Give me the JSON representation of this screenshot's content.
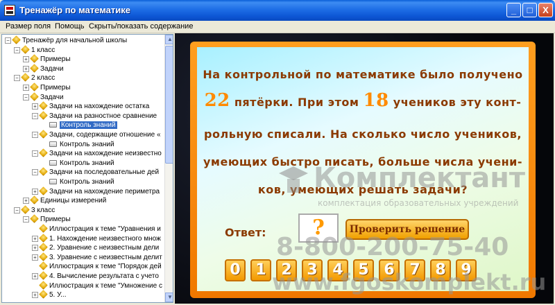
{
  "window": {
    "title": "Тренажёр по математике",
    "buttons": {
      "minimize": "_",
      "maximize": "□",
      "close": "X"
    }
  },
  "menu": [
    "Размер поля",
    "Помощь",
    "Скрыть/показать содержание"
  ],
  "tree": [
    {
      "label": "Тренажёр для начальной школы",
      "level": 0,
      "expander": "−"
    },
    {
      "label": "1 класс",
      "level": 1,
      "expander": "−"
    },
    {
      "label": "Примеры",
      "level": 2,
      "expander": "+"
    },
    {
      "label": "Задачи",
      "level": 2,
      "expander": "+"
    },
    {
      "label": "2 класс",
      "level": 1,
      "expander": "−"
    },
    {
      "label": "Примеры",
      "level": 2,
      "expander": "+"
    },
    {
      "label": "Задачи",
      "level": 2,
      "expander": "−"
    },
    {
      "label": "Задачи на нахождение остатка",
      "level": 3,
      "expander": "+"
    },
    {
      "label": "Задачи на разностное сравнение",
      "level": 3,
      "expander": "−"
    },
    {
      "label": "Контроль знаний",
      "level": 4,
      "expander": "",
      "selected": true,
      "leaf": true
    },
    {
      "label": "Задачи, содержащие отношение «",
      "level": 3,
      "expander": "−"
    },
    {
      "label": "Контроль знаний",
      "level": 4,
      "expander": "",
      "leaf": true
    },
    {
      "label": "Задачи на нахождение неизвестно",
      "level": 3,
      "expander": "−"
    },
    {
      "label": "Контроль знаний",
      "level": 4,
      "expander": "",
      "leaf": true
    },
    {
      "label": "Задачи на последовательные дей",
      "level": 3,
      "expander": "−"
    },
    {
      "label": "Контроль знаний",
      "level": 4,
      "expander": "",
      "leaf": true
    },
    {
      "label": "Задачи на нахождение периметра",
      "level": 3,
      "expander": "+"
    },
    {
      "label": "Единицы измерений",
      "level": 2,
      "expander": "+"
    },
    {
      "label": "3 класс",
      "level": 1,
      "expander": "−"
    },
    {
      "label": "Примеры",
      "level": 2,
      "expander": "−"
    },
    {
      "label": "Иллюстрация к теме \"Уравнения и",
      "level": 3,
      "expander": ""
    },
    {
      "label": "1. Нахождение неизвестного множ",
      "level": 3,
      "expander": "+"
    },
    {
      "label": "2. Уравнение с неизвестным дели",
      "level": 3,
      "expander": "+"
    },
    {
      "label": "3. Уравнение с неизвестным делит",
      "level": 3,
      "expander": "+"
    },
    {
      "label": "Иллюстрация к теме \"Порядок дей",
      "level": 3,
      "expander": ""
    },
    {
      "label": "4. Вычисление результата с учето",
      "level": 3,
      "expander": "+"
    },
    {
      "label": "Иллюстрация к теме \"Умножение с",
      "level": 3,
      "expander": ""
    },
    {
      "label": "5. У...",
      "level": 3,
      "expander": "+"
    }
  ],
  "scrollbar": {
    "up": "▲",
    "down": "▼"
  },
  "problem": {
    "line1": "На контрольной по математике было получено",
    "num1": "22",
    "line2_a": "пятёрки. При этом",
    "num2": "18",
    "line2_b": "учеников эту конт-",
    "line3": "рольную списали. На сколько число учеников,",
    "line4": "умеющих быстро писать, больше числа учени-",
    "line5": "ков, умеющих решать задачи?"
  },
  "answer": {
    "label": "Ответ:",
    "value": "?",
    "check_button": "Проверить решение"
  },
  "digits": [
    "0",
    "1",
    "2",
    "3",
    "4",
    "5",
    "6",
    "7",
    "8",
    "9"
  ],
  "watermark": {
    "brand": "Комплектант",
    "tagline": "комплектация образовательных учреждений",
    "phone": "8-800-200-75-40",
    "site": "www.fgoskomplekt.ru"
  }
}
